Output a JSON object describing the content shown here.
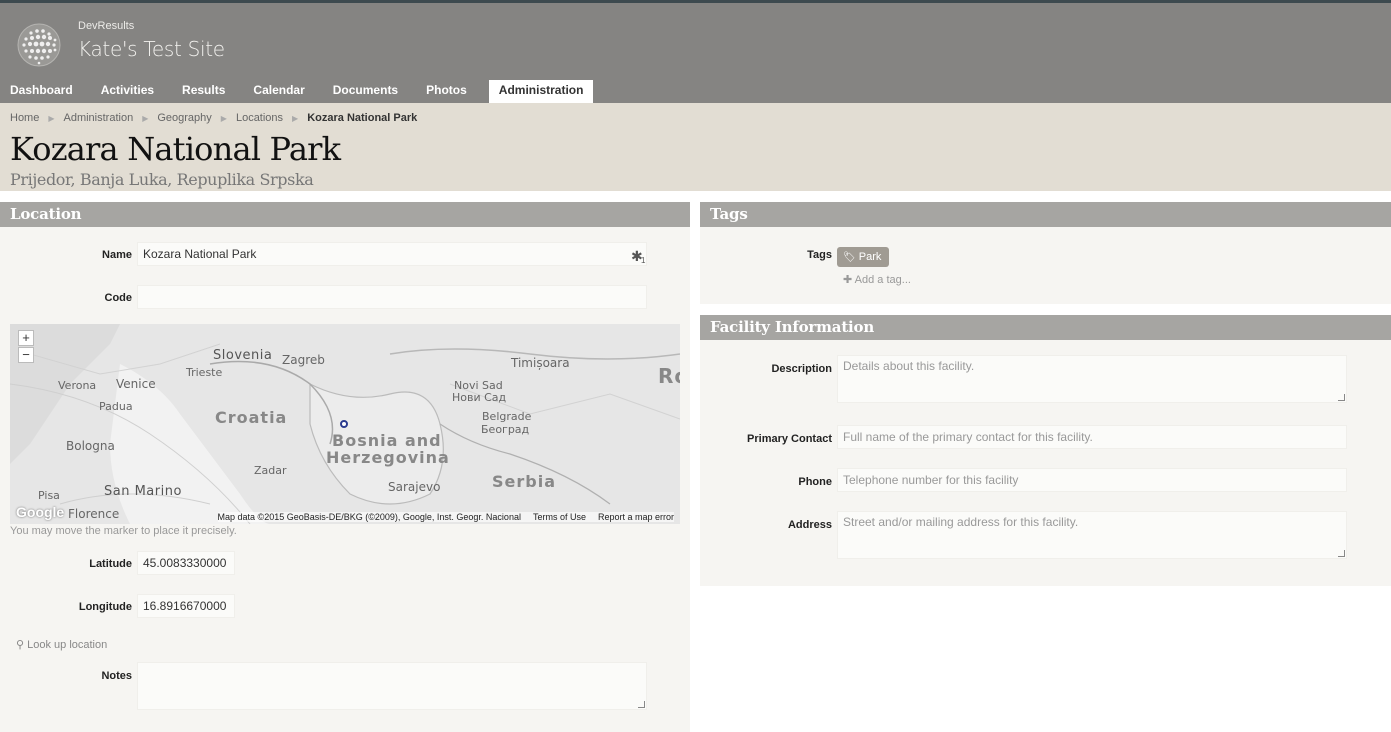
{
  "app": {
    "brand": "DevResults",
    "site_name": "Kate's Test Site"
  },
  "nav": {
    "items": [
      {
        "label": "Dashboard"
      },
      {
        "label": "Activities"
      },
      {
        "label": "Results"
      },
      {
        "label": "Calendar"
      },
      {
        "label": "Documents"
      },
      {
        "label": "Photos"
      },
      {
        "label": "Administration",
        "active": true
      }
    ]
  },
  "breadcrumb": {
    "items": [
      "Home",
      "Administration",
      "Geography",
      "Locations"
    ],
    "current": "Kozara National Park"
  },
  "page": {
    "title": "Kozara National Park",
    "subtitle": "Prijedor, Banja Luka, Repuplika Srpska"
  },
  "location": {
    "heading": "Location",
    "name_label": "Name",
    "name_value": "Kozara National Park",
    "code_label": "Code",
    "code_value": "",
    "map": {
      "labels": {
        "slovenia": "Slovenia",
        "zagreb": "Zagreb",
        "timisoara": "Timișoara",
        "trieste": "Trieste",
        "verona": "Verona",
        "venice": "Venice",
        "padua": "Padua",
        "croatia": "Croatia",
        "novi_sad": "Novi Sad",
        "novi_sad_cyr": "Нови Сад",
        "belgrade": "Belgrade",
        "belgrade_cyr": "Београд",
        "bosnia1": "Bosnia and",
        "bosnia2": "Herzegovina",
        "bologna": "Bologna",
        "zadar": "Zadar",
        "sarajevo": "Sarajevo",
        "serbia": "Serbia",
        "pisa": "Pisa",
        "san_marino": "San Marino",
        "florence": "Florence",
        "ro": "Ro"
      },
      "google": "Google",
      "attribution": "Map data ©2015 GeoBasis-DE/BKG (©2009), Google, Inst. Geogr. Nacional",
      "terms": "Terms of Use",
      "report": "Report a map error",
      "zoom_in": "+",
      "zoom_out": "−"
    },
    "marker_hint": "You may move the marker to place it precisely.",
    "latitude_label": "Latitude",
    "latitude_value": "45.0083330000",
    "longitude_label": "Longitude",
    "longitude_value": "16.8916670000",
    "lookup_label": "Look up location",
    "notes_label": "Notes",
    "notes_value": ""
  },
  "tags": {
    "heading": "Tags",
    "label": "Tags",
    "items": [
      "Park"
    ],
    "add_label": "Add a tag..."
  },
  "facility": {
    "heading": "Facility Information",
    "description_label": "Description",
    "description_placeholder": "Details about this facility.",
    "contact_label": "Primary Contact",
    "contact_placeholder": "Full name of the primary contact for this facility.",
    "phone_label": "Phone",
    "phone_placeholder": "Telephone number for this facility",
    "address_label": "Address",
    "address_placeholder": "Street and/or mailing address for this facility."
  },
  "colors": {
    "header_bg": "#858482",
    "titlebar_bg": "#e2ddd3",
    "panel_head": "#a6a5a2",
    "tag_bg": "#a09b93",
    "marker": "#2b3b8f"
  }
}
